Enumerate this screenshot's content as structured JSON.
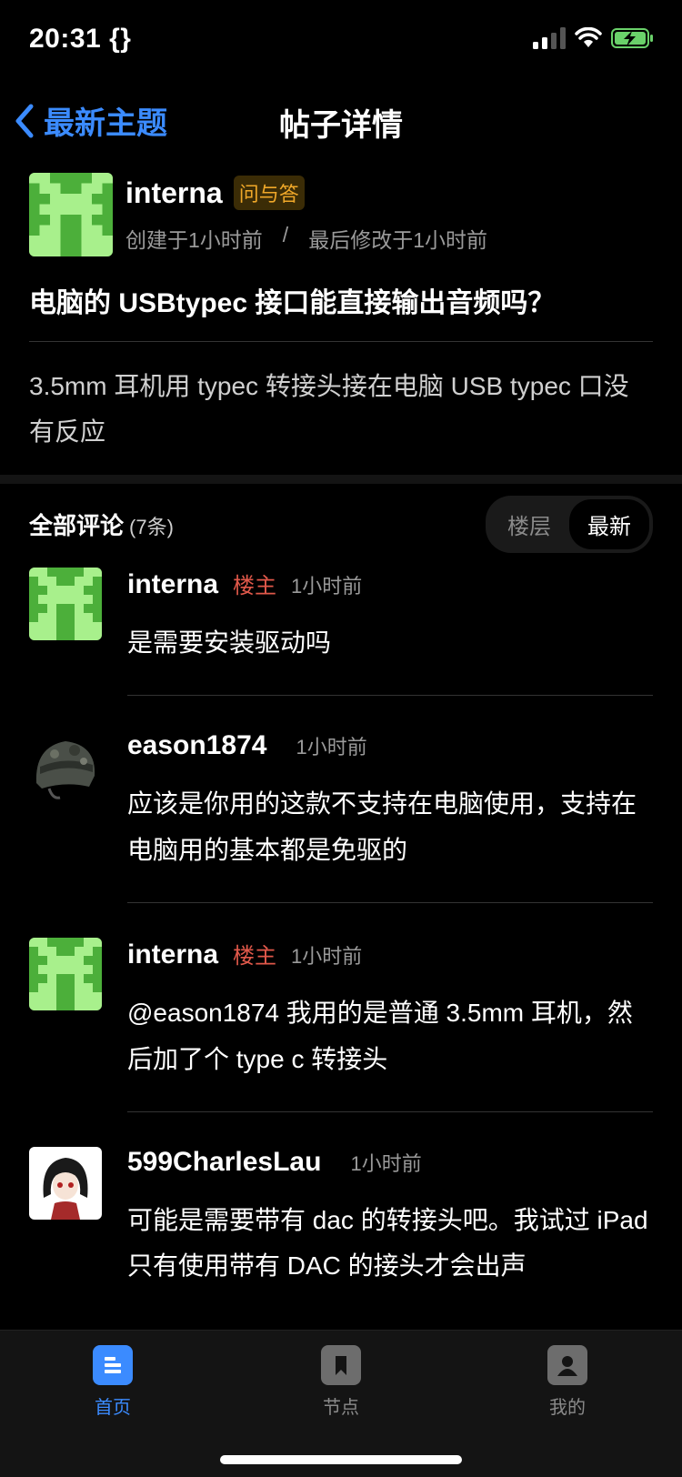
{
  "status": {
    "time": "20:31",
    "extra": "{}"
  },
  "nav": {
    "back_label": "最新主题",
    "title": "帖子详情"
  },
  "post": {
    "author": "interna",
    "tag": "问与答",
    "created": "创建于1小时前",
    "sep": "/",
    "modified": "最后修改于1小时前",
    "title": "电脑的 USBtypec 接口能直接输出音频吗？",
    "body": "3.5mm 耳机用 typec 转接头接在电脑 USB typec 口没有反应"
  },
  "comments": {
    "title": "全部评论",
    "count": "(7条)",
    "sort": [
      {
        "label": "楼层",
        "active": false
      },
      {
        "label": "最新",
        "active": true
      }
    ],
    "items": [
      {
        "author": "interna",
        "op_label": "楼主",
        "time": "1小时前",
        "text": "是需要安装驱动吗",
        "avatar": "pixel"
      },
      {
        "author": "eason1874",
        "op_label": "",
        "time": "1小时前",
        "text": "应该是你用的这款不支持在电脑使用，支持在电脑用的基本都是免驱的",
        "avatar": "helmet"
      },
      {
        "author": "interna",
        "op_label": "楼主",
        "time": "1小时前",
        "text": "@eason1874 我用的是普通 3.5mm 耳机，然后加了个 type c 转接头",
        "avatar": "pixel"
      },
      {
        "author": "599CharlesLau",
        "op_label": "",
        "time": "1小时前",
        "text": "可能是需要带有 dac 的转接头吧。我试过 iPad 只有使用带有 DAC 的接头才会出声",
        "avatar": "anime"
      }
    ]
  },
  "tabbar": [
    {
      "label": "首页",
      "icon": "home-icon",
      "active": true
    },
    {
      "label": "节点",
      "icon": "bookmark-icon",
      "active": false
    },
    {
      "label": "我的",
      "icon": "profile-icon",
      "active": false
    }
  ],
  "colors": {
    "accent": "#3b8bff",
    "op": "#e0584a",
    "tag": "#f0a829",
    "pixel_green": "#6ad16a"
  }
}
